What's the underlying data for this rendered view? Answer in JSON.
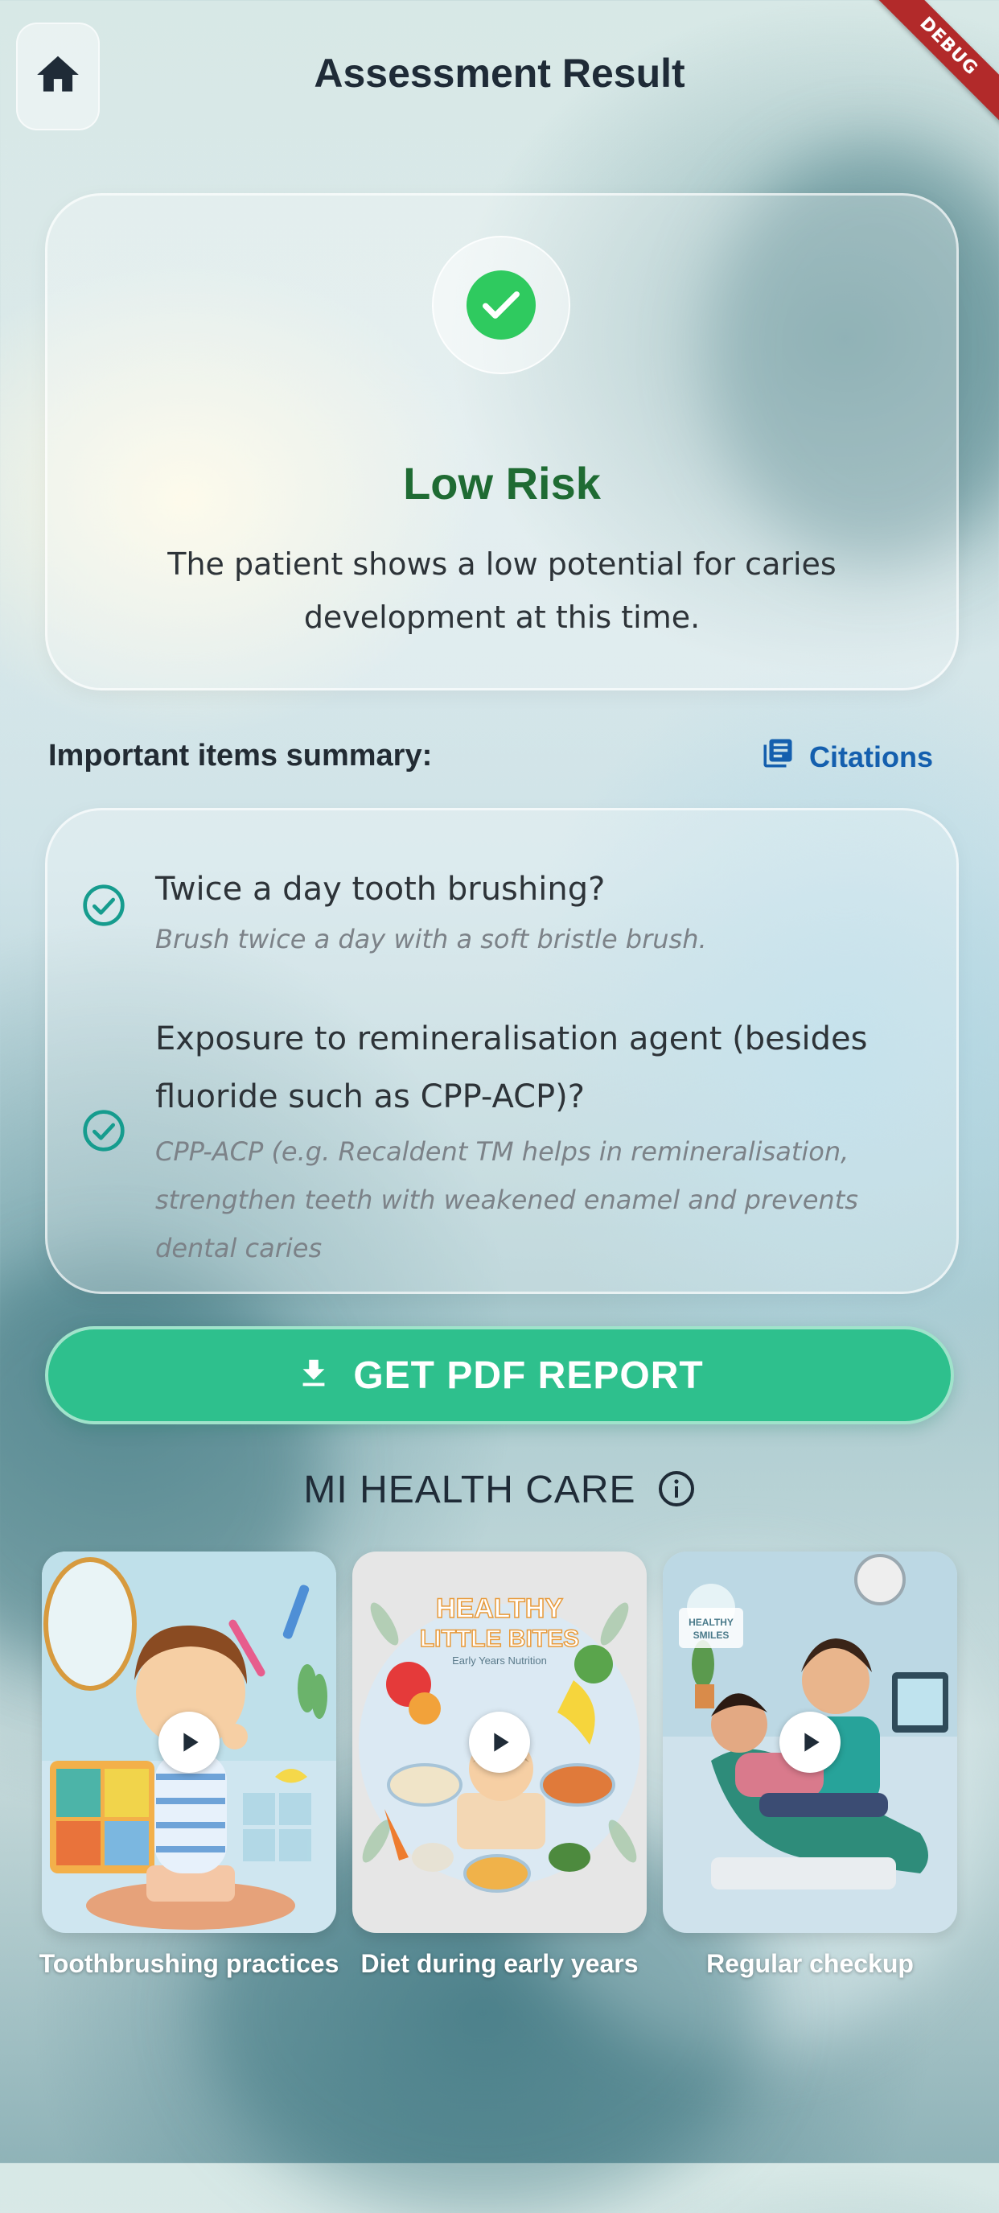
{
  "header": {
    "title": "Assessment Result",
    "home_icon": "home-icon",
    "debug_banner": "DEBUG"
  },
  "result": {
    "status_icon": "check-icon",
    "risk_level": "Low Risk",
    "description": "The patient shows a low potential for caries development at this time.",
    "colors": {
      "risk_text": "#1f6b33",
      "check": "#2fca5f"
    }
  },
  "summary": {
    "label": "Important items summary:",
    "citations_label": "Citations",
    "citations_icon": "library-books-icon",
    "items": [
      {
        "question": "Twice a day tooth brushing?",
        "hint": "Brush twice a day with a soft bristle brush.",
        "icon": "check-circle-outline-icon"
      },
      {
        "question": "Exposure to remineralisation agent (besides fluoride such as CPP-ACP)?",
        "hint": " CPP-ACP (e.g. Recaldent TM helps in remineralisation, strengthen teeth with weakened enamel and prevents dental caries",
        "icon": "check-circle-outline-icon"
      }
    ]
  },
  "actions": {
    "pdf_label": "GET PDF REPORT",
    "pdf_icon": "download-icon",
    "accent": "#2ec08d"
  },
  "videos": {
    "section_title": "MI HEALTH CARE",
    "info_icon": "info-icon",
    "items": [
      {
        "label": "Toothbrushing practices",
        "icon": "play-icon"
      },
      {
        "label": "Diet during early years",
        "icon": "play-icon",
        "art_title_1": "HEALTHY",
        "art_title_2": "LITTLE BITES",
        "art_sub": "Early Years Nutrition"
      },
      {
        "label": "Regular checkup",
        "icon": "play-icon",
        "art_sign_1": "HEALTHY",
        "art_sign_2": "SMILES"
      }
    ]
  }
}
